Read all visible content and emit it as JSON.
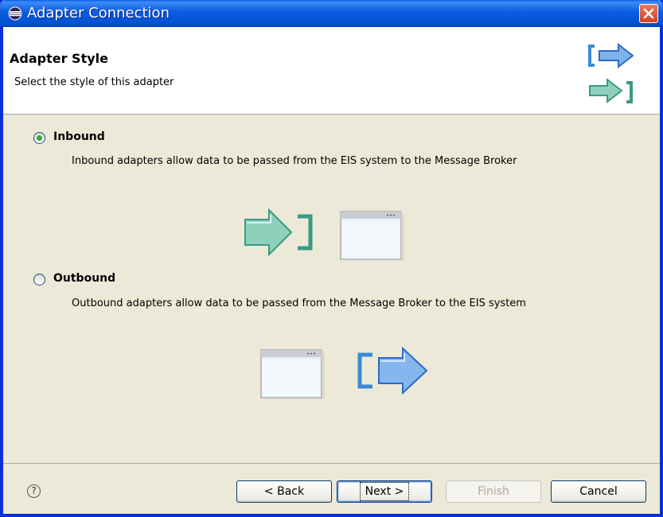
{
  "window": {
    "title": "Adapter Connection",
    "accent_color": "#0a5ce0",
    "title_icon": "eclipse-icon",
    "close_icon": "close-icon"
  },
  "header": {
    "title": "Adapter Style",
    "description": "Select the style of this adapter",
    "graphic_icon": "adapter-wizard-icon"
  },
  "options": [
    {
      "label": "Inbound",
      "selected": true,
      "description": "Inbound adapters allow data to be passed from the EIS system to the Message Broker",
      "illustration": "inbound-illustration"
    },
    {
      "label": "Outbound",
      "selected": false,
      "description": "Outbound adapters allow data to be passed from the Message Broker to the EIS system",
      "illustration": "outbound-illustration"
    }
  ],
  "footer": {
    "help_icon": "help-icon",
    "help_glyph": "?",
    "back": "< Back",
    "next": "Next >",
    "finish": "Finish",
    "cancel": "Cancel",
    "finish_enabled": false
  }
}
